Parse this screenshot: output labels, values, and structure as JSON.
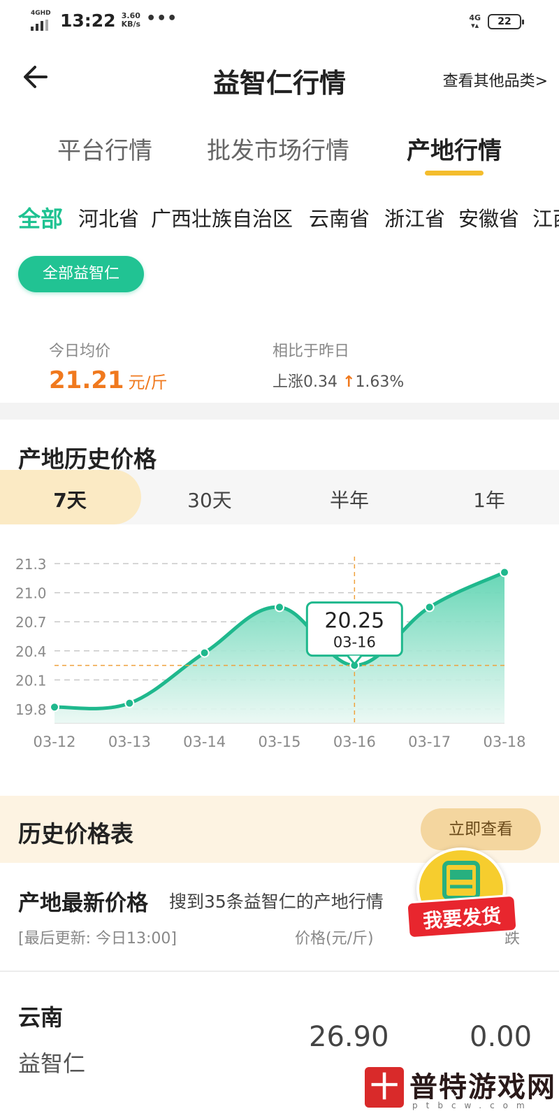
{
  "status_bar": {
    "network_left": "4GHD",
    "time": "13:22",
    "speed_value": "3.60",
    "speed_unit": "KB/s",
    "more": "•••",
    "network_right": "4G",
    "battery": "22"
  },
  "nav": {
    "title": "益智仁行情",
    "other_link": "查看其他品类>"
  },
  "tabs": [
    {
      "label": "平台行情",
      "active": false
    },
    {
      "label": "批发市场行情",
      "active": false
    },
    {
      "label": "产地行情",
      "active": true
    }
  ],
  "regions": [
    "全部",
    "河北省",
    "广西壮族自治区",
    "云南省",
    "浙江省",
    "安徽省",
    "江西"
  ],
  "filter_chip": "全部益智仁",
  "today": {
    "avg_label": "今日均价",
    "avg_price": "21.21",
    "avg_unit": "元/斤",
    "compare_label": "相比于昨日",
    "change_prefix": "上涨0.34",
    "change_arrow": "↑",
    "change_percent": "1.63%"
  },
  "history_section": {
    "title": "产地历史价格",
    "ranges": [
      {
        "label": "7天",
        "active": true
      },
      {
        "label": "30天",
        "active": false
      },
      {
        "label": "半年",
        "active": false
      },
      {
        "label": "1年",
        "active": false
      }
    ]
  },
  "chart_data": {
    "type": "area",
    "x": [
      "03-12",
      "03-13",
      "03-14",
      "03-15",
      "03-16",
      "03-17",
      "03-18"
    ],
    "series": [
      {
        "values": [
          19.82,
          19.86,
          20.38,
          20.85,
          20.25,
          20.85,
          21.21
        ]
      }
    ],
    "ylim": [
      19.8,
      21.3
    ],
    "yticks": [
      "21.3",
      "21.0",
      "20.7",
      "20.4",
      "20.1",
      "19.8"
    ],
    "ytick_values": [
      21.3,
      21.0,
      20.7,
      20.4,
      20.1,
      19.8
    ],
    "tooltip": {
      "value": "20.25",
      "date": "03-16"
    },
    "colors": {
      "line": "#1fb88d",
      "fill_top": "#5fd4b2",
      "fill_bottom": "#e9f8f3",
      "marker": "#f0a13c"
    },
    "grid": "dashed"
  },
  "history_table": {
    "title": "历史价格表",
    "button": "立即查看"
  },
  "latest": {
    "title": "产地最新价格",
    "subtitle": "搜到35条益智仁的产地行情",
    "update": "[最后更新: 今日13:00]",
    "col_price": "价格(元/斤)",
    "col_change": "跌"
  },
  "rows": [
    {
      "region": "云南",
      "product": "益智仁",
      "price": "26.90",
      "change": "0.00"
    }
  ],
  "fab": {
    "label": "我要发货"
  },
  "watermark": {
    "badge": "十",
    "text": "普特游戏网",
    "sub": "ptbcw.com"
  }
}
